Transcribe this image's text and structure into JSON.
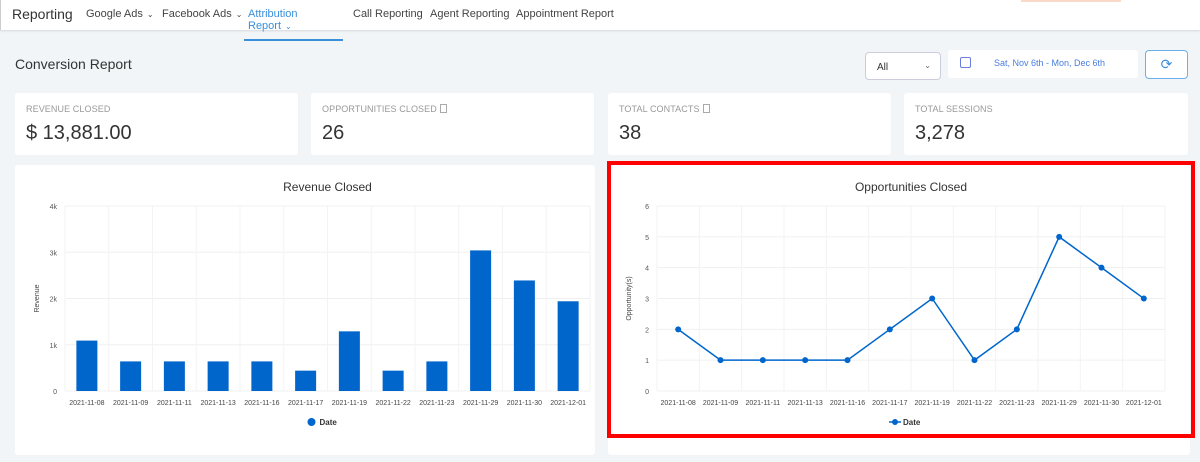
{
  "nav": {
    "brand": "Reporting",
    "items": [
      {
        "label": "Google Ads",
        "dropdown": true
      },
      {
        "label": "Facebook Ads",
        "dropdown": true
      },
      {
        "label": "Attribution Report",
        "dropdown": true,
        "active": true
      },
      {
        "label": "Call Reporting"
      },
      {
        "label": "Agent Reporting"
      },
      {
        "label": "Appointment Report"
      }
    ]
  },
  "page_title": "Conversion Report",
  "filter": {
    "selected": "All"
  },
  "date_range": "Sat, Nov 6th - Mon, Dec 6th",
  "stats": [
    {
      "label": "REVENUE CLOSED",
      "value": "$ 13,881.00"
    },
    {
      "label": "OPPORTUNITIES CLOSED",
      "value": "26"
    },
    {
      "label": "TOTAL CONTACTS",
      "value": "38"
    },
    {
      "label": "TOTAL SESSIONS",
      "value": "3,278"
    }
  ],
  "colors": {
    "accent": "#3a8fd9",
    "series": "#0066cc",
    "highlight": "#ff0000"
  },
  "chart_data": [
    {
      "type": "bar",
      "title": "Revenue Closed",
      "xlabel": "",
      "ylabel": "Revenue",
      "legend": "Date",
      "legend_position": "bottom",
      "ylim": [
        0,
        4000
      ],
      "yticks": [
        "0",
        "1k",
        "2k",
        "3k",
        "4k"
      ],
      "categories": [
        "2021-11-08",
        "2021-11-09",
        "2021-11-11",
        "2021-11-13",
        "2021-11-16",
        "2021-11-17",
        "2021-11-19",
        "2021-11-22",
        "2021-11-23",
        "2021-11-29",
        "2021-11-30",
        "2021-12-01"
      ],
      "values": [
        1090,
        640,
        640,
        640,
        640,
        440,
        1290,
        440,
        640,
        3040,
        2390,
        1940
      ]
    },
    {
      "type": "line",
      "title": "Opportunities Closed",
      "xlabel": "",
      "ylabel": "Opportunity(s)",
      "legend": "Date",
      "legend_position": "bottom",
      "ylim": [
        0,
        6
      ],
      "yticks": [
        "0",
        "1",
        "2",
        "3",
        "4",
        "5",
        "6"
      ],
      "categories": [
        "2021-11-08",
        "2021-11-09",
        "2021-11-11",
        "2021-11-13",
        "2021-11-16",
        "2021-11-17",
        "2021-11-19",
        "2021-11-22",
        "2021-11-23",
        "2021-11-29",
        "2021-11-30",
        "2021-12-01"
      ],
      "values": [
        2,
        1,
        1,
        1,
        1,
        2,
        3,
        1,
        2,
        5,
        4,
        3
      ]
    }
  ]
}
